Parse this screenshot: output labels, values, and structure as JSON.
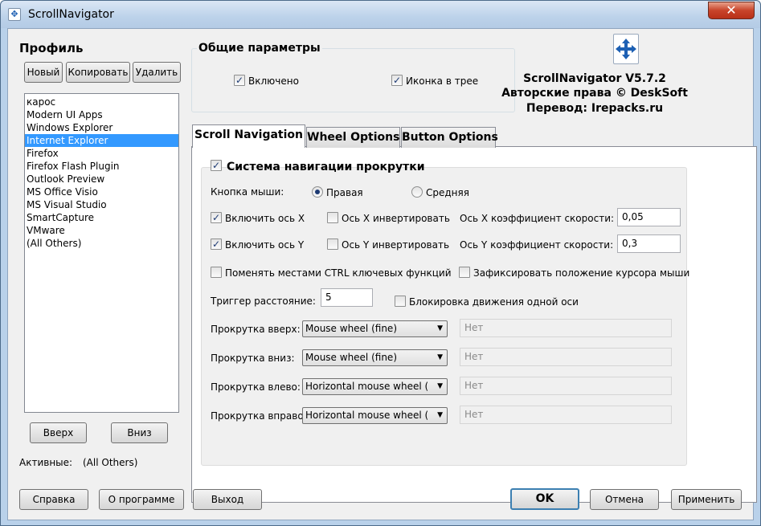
{
  "window": {
    "title": "ScrollNavigator",
    "close_glyph": "✕",
    "icon": "app-arrows-icon"
  },
  "profile": {
    "heading": "Профиль",
    "buttons": {
      "new": "Новый",
      "copy": "Копировать",
      "delete": "Удалить"
    },
    "items": [
      "карос",
      "Modern UI Apps",
      "Windows Explorer",
      "Internet Explorer",
      "Firefox",
      "Firefox Flash Plugin",
      "Outlook Preview",
      "MS Office Visio",
      "MS Visual Studio",
      "SmartCapture",
      "VMware",
      "(All Others)"
    ],
    "selected_index": 3,
    "up": "Вверх",
    "down": "Вниз",
    "active_label": "Активные:",
    "active_value": "(All Others)"
  },
  "general": {
    "heading": "Общие параметры",
    "enabled_label": "Включено",
    "enabled_checked": true,
    "tray_label": "Иконка в трее",
    "tray_checked": true
  },
  "about": {
    "line1": "ScrollNavigator V5.7.2",
    "line2": "Авторские права © DeskSoft",
    "line3": "Перевод: Irepacks.ru"
  },
  "tabs": [
    {
      "label": "Scroll Navigation",
      "active": true
    },
    {
      "label": "Wheel Options",
      "active": false
    },
    {
      "label": "Button Options",
      "active": false
    }
  ],
  "scroll": {
    "section_label": "Система навигации прокрутки",
    "section_checked": true,
    "mouse_button_label": "Кнопка мыши:",
    "right_label": "Правая",
    "middle_label": "Средняя",
    "selected_button": "right",
    "x_axis_label": "Включить ось X",
    "x_axis_checked": true,
    "x_invert_label": "Ось X инвертировать",
    "x_invert_checked": false,
    "x_speed_label": "Ось X коэффициент скорости:",
    "x_speed_value": "0,05",
    "y_axis_label": "Включить ось Y",
    "y_axis_checked": true,
    "y_invert_label": "Ось Y инвертировать",
    "y_invert_checked": false,
    "y_speed_label": "Ось Y коэффициент скорости:",
    "y_speed_value": "0,3",
    "swap_ctrl_label": "Поменять местами CTRL ключевых функций",
    "swap_ctrl_checked": false,
    "fix_cursor_label": "Зафиксировать положение курсора мыши",
    "fix_cursor_checked": false,
    "trigger_label": "Триггер расстояние:",
    "trigger_value": "5",
    "lock_axis_label": "Блокировка движения одной оси",
    "lock_axis_checked": false,
    "actions": [
      {
        "label": "Прокрутка вверх:",
        "combo": "Mouse wheel (fine)",
        "extra": "Нет"
      },
      {
        "label": "Прокрутка вниз:",
        "combo": "Mouse wheel (fine)",
        "extra": "Нет"
      },
      {
        "label": "Прокрутка влево:",
        "combo": "Horizontal mouse wheel (fi",
        "extra": "Нет"
      },
      {
        "label": "Прокрутка вправо:",
        "combo": "Horizontal mouse wheel (fi",
        "extra": "Нет"
      }
    ]
  },
  "footer": {
    "help": "Справка",
    "about": "О программе",
    "exit": "Выход",
    "ok": "OK",
    "cancel": "Отмена",
    "apply": "Применить"
  },
  "check_glyph": "✓",
  "combo_arrow_glyph": "▼"
}
